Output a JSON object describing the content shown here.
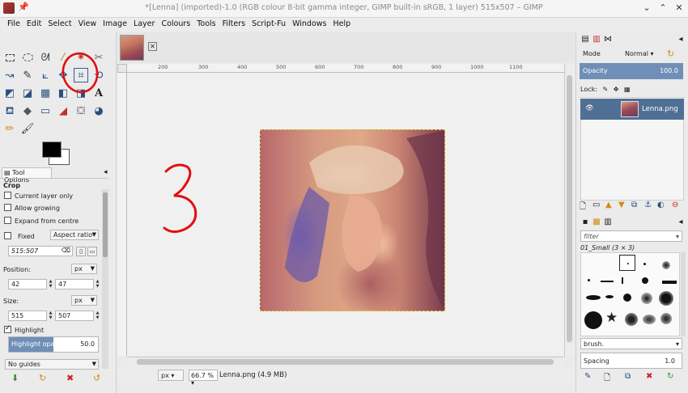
{
  "window": {
    "title": "*[Lenna] (imported)-1.0 (RGB colour 8-bit gamma integer, GIMP built-in sRGB, 1 layer) 515x507 – GIMP",
    "pin_icon": "pin-icon",
    "min_icon": "minimize-icon",
    "max_icon": "maximize-icon",
    "close_icon": "close-icon"
  },
  "menubar": {
    "items": [
      "File",
      "Edit",
      "Select",
      "View",
      "Image",
      "Layer",
      "Colours",
      "Tools",
      "Filters",
      "Script-Fu",
      "Windows",
      "Help"
    ]
  },
  "tool_options": {
    "tab_label": "Tool Options",
    "title": "Crop",
    "current_layer_only": "Current layer only",
    "allow_growing": "Allow growing",
    "expand_from_centre": "Expand from centre",
    "fixed_label": "Fixed",
    "fixed_mode": "Aspect ratio",
    "ratio_value": "515:507",
    "position_label": "Position:",
    "position_unit": "px",
    "position_x": "42",
    "position_y": "47",
    "size_label": "Size:",
    "size_unit": "px",
    "size_w": "515",
    "size_h": "507",
    "highlight_label": "Highlight",
    "highlight_opacity_label": "Highlight opacity",
    "highlight_opacity_value": "50.0",
    "highlight_opacity_fraction": 0.5,
    "guides": "No guides"
  },
  "canvas": {
    "ruler_ticks": [
      "200",
      "300",
      "400",
      "500",
      "600",
      "700",
      "800",
      "900",
      "1000",
      "1100"
    ],
    "handwritten": "3"
  },
  "status": {
    "unit": "px",
    "zoom": "66.7 %",
    "message": "Lenna.png (4.9 MB)"
  },
  "layers": {
    "mode_label": "Mode",
    "mode_value": "Normal",
    "opacity_label": "Opacity",
    "opacity_value": "100.0",
    "lock_label": "Lock:",
    "layer_name": "Lenna.png"
  },
  "brushes": {
    "filter_placeholder": "filter",
    "current_brush": "01_Small (3 × 3)",
    "tag_value": "brush.",
    "spacing_label": "Spacing",
    "spacing_value": "1.0"
  },
  "colors": {
    "accent": "#6f8fb7",
    "layer_selected": "#506f94",
    "annotation_red": "#e01010",
    "foreground": "#000000",
    "background": "#ffffff"
  }
}
